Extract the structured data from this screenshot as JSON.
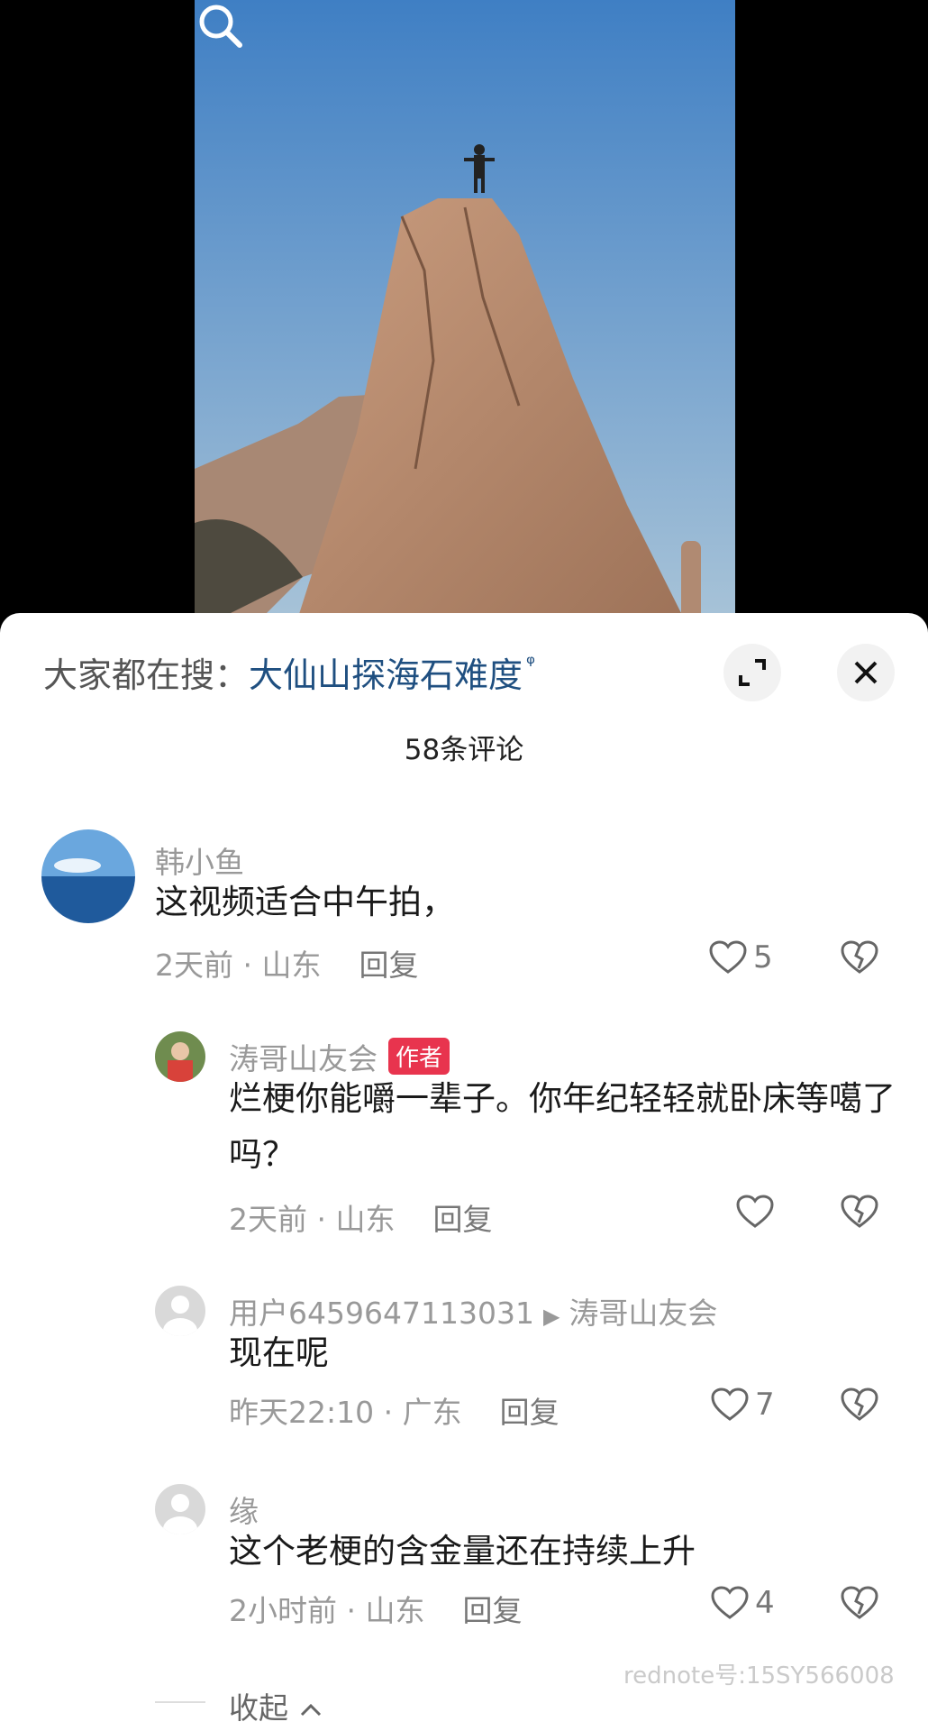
{
  "search": {
    "prefix": "大家都在搜：",
    "keyword": "大仙山探海石难度",
    "magnifier": "ᵠ"
  },
  "comments_count": "58条评论",
  "comments": [
    {
      "user": "韩小鱼",
      "text": "这视频适合中午拍，",
      "time_loc": "2天前 · 山东",
      "reply": "回复",
      "likes": "5"
    },
    {
      "user": "涛哥山友会",
      "badge": "作者",
      "text": "烂梗你能嚼一辈子。你年纪轻轻就卧床等噶了吗？",
      "time_loc": "2天前 · 山东",
      "reply": "回复",
      "likes": ""
    },
    {
      "user": "用户6459647113031",
      "reply_to": "涛哥山友会",
      "text": "现在呢",
      "time_loc": "昨天22:10 · 广东",
      "reply": "回复",
      "likes": "7"
    },
    {
      "user": "缘",
      "text": "这个老梗的含金量还在持续上升",
      "time_loc": "2小时前 · 山东",
      "reply": "回复",
      "likes": "4"
    }
  ],
  "collapse": "收起",
  "watermark": "rednote号:15SY566008",
  "icons": {
    "search": "search-icon",
    "expand": "expand-icon",
    "close": "close-icon",
    "like": "heart-icon",
    "dislike": "broken-heart-icon"
  }
}
